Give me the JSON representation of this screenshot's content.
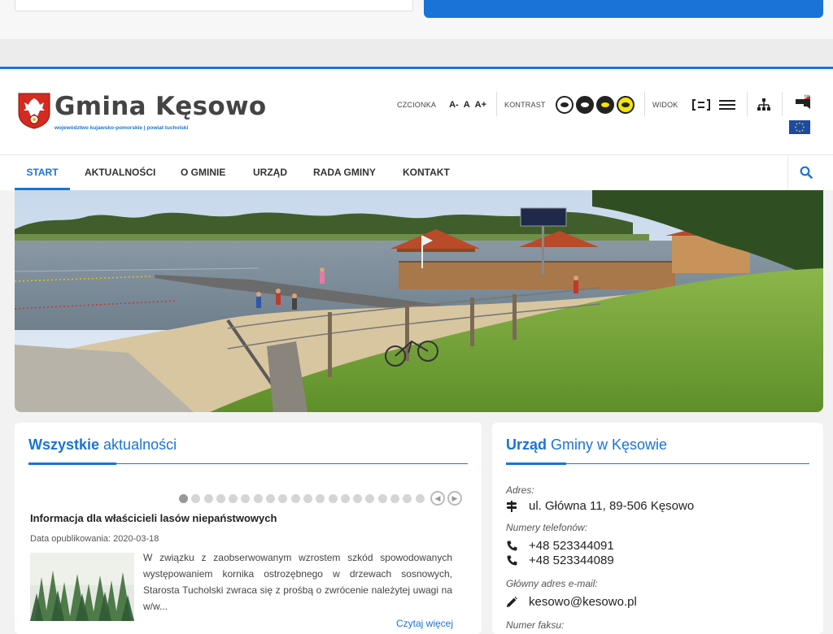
{
  "site": {
    "title": "Gmina Kęsowo",
    "subtitle": "województwo kujawsko-pomorskie | powiat tucholski"
  },
  "toolbar": {
    "font_label": "CZCIONKA",
    "font_smaller": "A-",
    "font_normal": "A",
    "font_larger": "A+",
    "contrast_label": "KONTRAST",
    "view_label": "WIDOK",
    "bip_label": "bip"
  },
  "nav": {
    "items": [
      {
        "label": "START"
      },
      {
        "label": "AKTUALNOŚCI"
      },
      {
        "label": "O GMINIE"
      },
      {
        "label": "URZĄD"
      },
      {
        "label": "RADA GMINY"
      },
      {
        "label": "KONTAKT"
      }
    ]
  },
  "news": {
    "title_strong": "Wszystkie",
    "title_rest": " aktualności",
    "dot_count": 20,
    "active_dot": 1,
    "item": {
      "title": "Informacja dla właścicieli lasów niepaństwowych",
      "date": "Data opublikowania: 2020-03-18",
      "excerpt": "W związku z zaobserwowanym wzrostem szkód spowodowanych występowaniem kornika ostrozębnego w drzewach sosnowych, Starosta Tucholski zwraca się z prośbą o zwrócenie należytej uwagi na w/w...",
      "more": "Czytaj więcej"
    }
  },
  "office": {
    "title_strong": "Urząd",
    "title_rest": " Gminy w Kęsowie",
    "address_label": "Adres:",
    "address": "ul. Główna 11, 89-506 Kęsowo",
    "phones_label": "Numery telefonów:",
    "phone1": "+48 523344091",
    "phone2": "+48 523344089",
    "email_label": "Główny adres e-mail:",
    "email": "kesowo@kesowo.pl",
    "fax_label": "Numer faksu:"
  },
  "colors": {
    "accent": "#1a73d6",
    "contrast_yellow": "#f5e500"
  }
}
